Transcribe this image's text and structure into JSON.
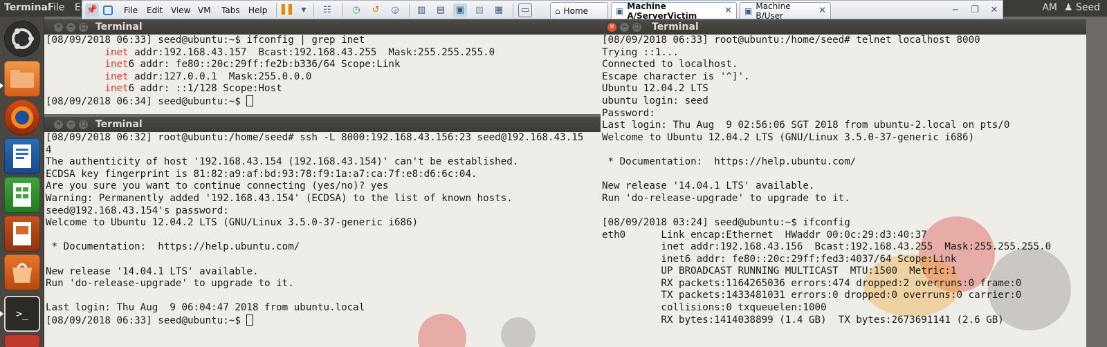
{
  "top_panel": {
    "app_title": "Terminal",
    "menu": [
      "File",
      "Ec"
    ],
    "time": "AM",
    "user": "Seed"
  },
  "launcher": {
    "items": [
      "dash-home",
      "files",
      "firefox",
      "writer",
      "calc",
      "impress",
      "software-center",
      "terminal"
    ]
  },
  "vm_toolbar": {
    "menus": [
      "File",
      "Edit",
      "View",
      "VM",
      "Tabs",
      "Help"
    ],
    "tabs": [
      {
        "label": "Home"
      },
      {
        "label": "Machine A/ServerVictim",
        "close": "✕"
      },
      {
        "label": "Machine B/User",
        "close": "✕"
      }
    ]
  },
  "terminals": {
    "top_left": {
      "title": "Terminal",
      "lines": [
        "[08/09/2018 06:33] seed@ubuntu:~$ ifconfig | grep inet",
        "          inet addr:192.168.43.157  Bcast:192.168.43.255  Mask:255.255.255.0",
        "          inet6 addr: fe80::20c:29ff:fe2b:b336/64 Scope:Link",
        "          inet addr:127.0.0.1  Mask:255.0.0.0",
        "          inet6 addr: ::1/128 Scope:Host",
        "[08/09/2018 06:34] seed@ubuntu:~$ "
      ]
    },
    "bottom_left": {
      "title": "Terminal",
      "lines": [
        "[08/09/2018 06:32] root@ubuntu:/home/seed# ssh -L 8000:192.168.43.156:23 seed@192.168.43.15",
        "4",
        "The authenticity of host '192.168.43.154 (192.168.43.154)' can't be established.",
        "ECDSA key fingerprint is 81:82:a9:af:bd:93:78:f9:1a:a7:ca:7f:e8:d6:6c:04.",
        "Are you sure you want to continue connecting (yes/no)? yes",
        "Warning: Permanently added '192.168.43.154' (ECDSA) to the list of known hosts.",
        "seed@192.168.43.154's password:",
        "Welcome to Ubuntu 12.04.2 LTS (GNU/Linux 3.5.0-37-generic i686)",
        "",
        " * Documentation:  https://help.ubuntu.com/",
        "",
        "New release '14.04.1 LTS' available.",
        "Run 'do-release-upgrade' to upgrade to it.",
        "",
        "Last login: Thu Aug  9 06:04:47 2018 from ubuntu.local",
        "[08/09/2018 06:33] seed@ubuntu:~$ "
      ]
    },
    "right": {
      "title": "Terminal",
      "lines": [
        "[08/09/2018 06:33] root@ubuntu:/home/seed# telnet localhost 8000",
        "Trying ::1...",
        "Connected to localhost.",
        "Escape character is '^]'.",
        "Ubuntu 12.04.2 LTS",
        "ubuntu login: seed",
        "Password:",
        "Last login: Thu Aug  9 02:56:06 SGT 2018 from ubuntu-2.local on pts/0",
        "Welcome to Ubuntu 12.04.2 LTS (GNU/Linux 3.5.0-37-generic i686)",
        "",
        " * Documentation:  https://help.ubuntu.com/",
        "",
        "New release '14.04.1 LTS' available.",
        "Run 'do-release-upgrade' to upgrade to it.",
        "",
        "[08/09/2018 03:24] seed@ubuntu:~$ ifconfig",
        "eth0      Link encap:Ethernet  HWaddr 00:0c:29:d3:40:37",
        "          inet addr:192.168.43.156  Bcast:192.168.43.255  Mask:255.255.255.0",
        "          inet6 addr: fe80::20c:29ff:fed3:4037/64 Scope:Link",
        "          UP BROADCAST RUNNING MULTICAST  MTU:1500  Metric:1",
        "          RX packets:1164265036 errors:474 dropped:2 overruns:0 frame:0",
        "          TX packets:1433481031 errors:0 dropped:0 overruns:0 carrier:0",
        "          collisions:0 txqueuelen:1000",
        "          RX bytes:1414038899 (1.4 GB)  TX bytes:2673691141 (2.6 GB)"
      ]
    }
  },
  "colors": {
    "grep_highlight": "#e8302a",
    "close_button": "#e4552e",
    "terminal_bg": "#efede8"
  }
}
